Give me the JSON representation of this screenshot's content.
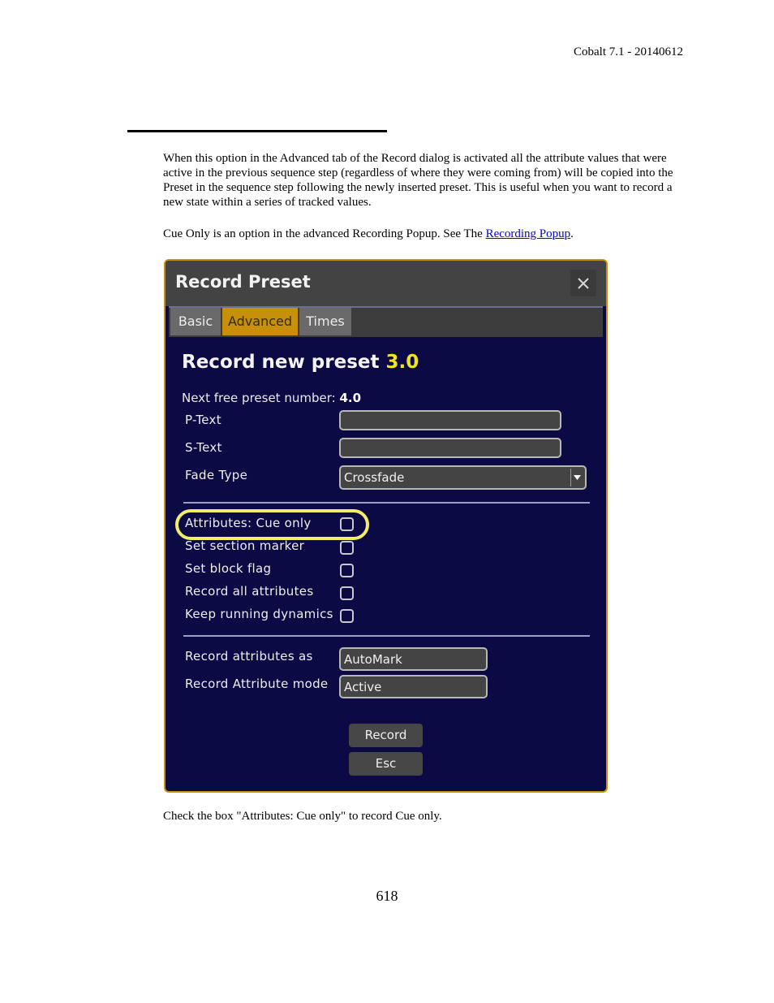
{
  "document": {
    "header": "Cobalt 7.1 - 20140612",
    "paragraph1": "When this option in the Advanced tab of the Record dialog is activated all the attribute values that were active in the previous sequence step (regardless of where they were coming from) will be copied into the Preset in the sequence step following the newly inserted preset. This is useful when you want to record a new state within a series of tracked values.",
    "paragraph2_prefix": "Cue Only is an option in the advanced Recording Popup. See The ",
    "paragraph2_link": "Recording Popup",
    "paragraph2_suffix": ".",
    "caption": "Check the box \"Attributes: Cue only\" to record Cue only.",
    "page_number": "618"
  },
  "dialog": {
    "title": "Record Preset",
    "close_icon": "close-icon",
    "tabs": [
      {
        "label": "Basic",
        "active": false
      },
      {
        "label": "Advanced",
        "active": true
      },
      {
        "label": "Times",
        "active": false
      }
    ],
    "heading_prefix": "Record new preset ",
    "heading_number": "3.0",
    "next_free_label": "Next free preset number: ",
    "next_free_value": "4.0",
    "fields": {
      "p_text": {
        "label": "P-Text",
        "value": ""
      },
      "s_text": {
        "label": "S-Text",
        "value": ""
      },
      "fade_type": {
        "label": "Fade Type",
        "value": "Crossfade"
      }
    },
    "checkboxes": [
      {
        "label": "Attributes: Cue only",
        "checked": false,
        "highlighted": true
      },
      {
        "label": "Set section marker",
        "checked": false
      },
      {
        "label": "Set block flag",
        "checked": false
      },
      {
        "label": "Record all attributes",
        "checked": false
      },
      {
        "label": "Keep running dynamics",
        "checked": false
      }
    ],
    "record_as": {
      "label": "Record attributes as",
      "value": "AutoMark"
    },
    "record_mode": {
      "label": "Record Attribute mode",
      "value": "Active"
    },
    "buttons": {
      "record": "Record",
      "esc": "Esc"
    },
    "colors": {
      "background": "#0b0a44",
      "frame": "#c8900a",
      "active_tab": "#c8900a",
      "highlight": "#f3ec6a",
      "preset_number": "#f1e520"
    }
  }
}
